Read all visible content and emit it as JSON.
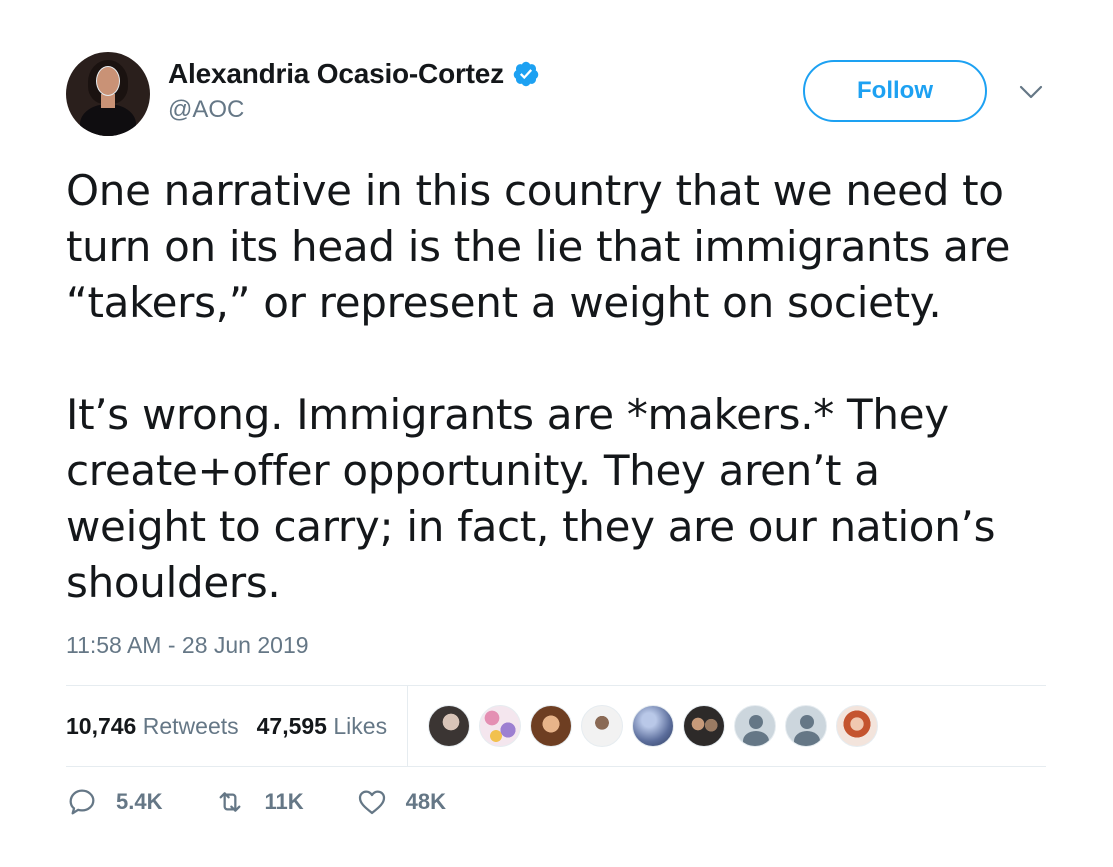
{
  "author": {
    "name": "Alexandria Ocasio-Cortez",
    "handle": "@AOC",
    "verified": true
  },
  "follow_button": {
    "label": "Follow"
  },
  "tweet": {
    "text": "One narrative in this country that we need to\nturn on its head is the lie that immigrants are\n“takers,” or represent a weight on society.\n\nIt’s wrong. Immigrants are *makers.* They\ncreate+offer opportunity. They aren’t a\nweight to carry; in fact, they are our nation’s\nshoulders.",
    "timestamp": "11:58 AM - 28 Jun 2019"
  },
  "stats": {
    "retweets_count": "10,746",
    "retweets_label": "Retweets",
    "likes_count": "47,595",
    "likes_label": "Likes"
  },
  "actions": {
    "replies": "5.4K",
    "retweets": "11K",
    "likes": "48K"
  },
  "colors": {
    "accent": "#1da1f2",
    "text": "#14171a",
    "secondary": "#657786",
    "border": "#e6ecf0"
  },
  "icons": [
    "verified-badge-icon",
    "chevron-down-icon",
    "reply-icon",
    "retweet-icon",
    "like-icon"
  ]
}
